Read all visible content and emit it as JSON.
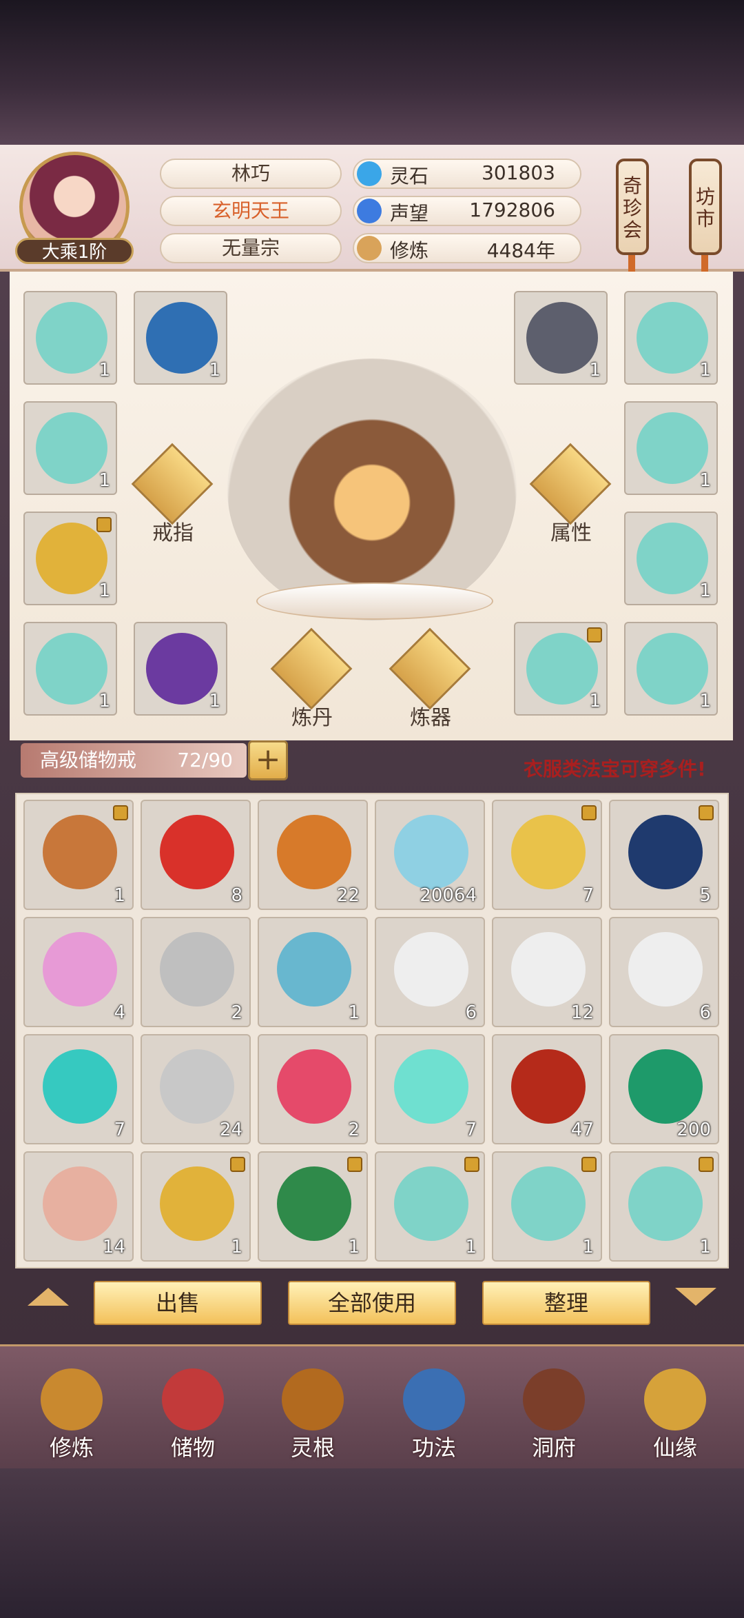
{
  "profile": {
    "rank": "大乘1阶",
    "name": "林巧",
    "title": "玄明天王",
    "sect": "无量宗"
  },
  "stats": [
    {
      "label": "灵石",
      "value": "301803",
      "icon": "spirit-stone-icon",
      "color": "#3aa6e8"
    },
    {
      "label": "声望",
      "value": "1792806",
      "icon": "reputation-icon",
      "color": "#3d7be0"
    },
    {
      "label": "修炼",
      "value": "4484年",
      "icon": "cultivation-icon",
      "color": "#d9a35a"
    }
  ],
  "scrolls": [
    {
      "label": "奇珍会"
    },
    {
      "label": "坊市"
    }
  ],
  "equipment": {
    "slots": [
      {
        "count": "1",
        "color": "#7fd3c8"
      },
      {
        "count": "1",
        "color": "#2f6fb3"
      },
      {
        "count": "1",
        "color": "#5d5f6d"
      },
      {
        "count": "1",
        "color": "#7fd3c8"
      },
      {
        "count": "1",
        "color": "#7fd3c8"
      },
      {
        "count": "1",
        "color": "#7fd3c8"
      },
      {
        "count": "1",
        "color": "#e1b23a"
      },
      {
        "count": "1",
        "color": "#7fd3c8"
      },
      {
        "count": "1",
        "color": "#7fd3c8"
      },
      {
        "count": "1",
        "color": "#6b3aa0"
      },
      {
        "count": "1",
        "color": "#7fd3c8"
      },
      {
        "count": "1",
        "color": "#7fd3c8"
      }
    ],
    "actions": [
      {
        "label": "戒指"
      },
      {
        "label": "属性"
      },
      {
        "label": "炼丹"
      },
      {
        "label": "炼器"
      }
    ]
  },
  "bag": {
    "title": "高级储物戒",
    "count": "72/90",
    "notice": "衣服类法宝可穿多件!"
  },
  "items": [
    {
      "count": "1",
      "color": "#c8773a"
    },
    {
      "count": "8",
      "color": "#d9312a"
    },
    {
      "count": "22",
      "color": "#d77a2a"
    },
    {
      "count": "20064",
      "color": "#8fd0e3"
    },
    {
      "count": "7",
      "color": "#e9c24a"
    },
    {
      "count": "5",
      "color": "#1f3a6e"
    },
    {
      "count": "4",
      "color": "#e79ad6"
    },
    {
      "count": "2",
      "color": "#bfbfbf"
    },
    {
      "count": "1",
      "color": "#68b7cf"
    },
    {
      "count": "6",
      "color": "#eeeeee"
    },
    {
      "count": "12",
      "color": "#eeeeee"
    },
    {
      "count": "6",
      "color": "#eeeeee"
    },
    {
      "count": "7",
      "color": "#36c9c0"
    },
    {
      "count": "24",
      "color": "#c8c8c8"
    },
    {
      "count": "2",
      "color": "#e54a6a"
    },
    {
      "count": "7",
      "color": "#6fe0d0"
    },
    {
      "count": "47",
      "color": "#b52a1a"
    },
    {
      "count": "200",
      "color": "#1e9a6a"
    },
    {
      "count": "14",
      "color": "#e7b0a0"
    },
    {
      "count": "1",
      "color": "#e1b23a"
    },
    {
      "count": "1",
      "color": "#2f8a4a"
    },
    {
      "count": "1",
      "color": "#7fd3c8"
    },
    {
      "count": "1",
      "color": "#7fd3c8"
    },
    {
      "count": "1",
      "color": "#7fd3c8"
    }
  ],
  "buttons": {
    "sell": "出售",
    "use_all": "全部使用",
    "sort": "整理"
  },
  "nav": [
    {
      "label": "修炼",
      "icon": "cultivation-nav-icon",
      "color": "#c9892f"
    },
    {
      "label": "储物",
      "icon": "storage-bag-icon",
      "color": "#c23a3a"
    },
    {
      "label": "灵根",
      "icon": "spirit-root-icon",
      "color": "#b26a1f"
    },
    {
      "label": "功法",
      "icon": "technique-book-icon",
      "color": "#3b6fb3"
    },
    {
      "label": "洞府",
      "icon": "cave-dwelling-icon",
      "color": "#7b3e2a"
    },
    {
      "label": "仙缘",
      "icon": "immortal-fate-icon",
      "color": "#d6a23a"
    }
  ]
}
